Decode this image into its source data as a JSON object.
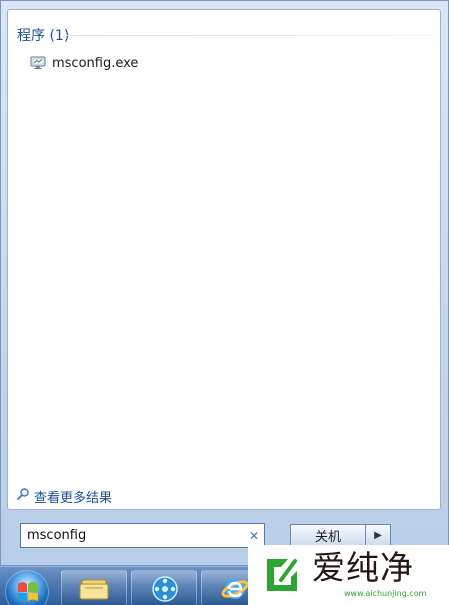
{
  "start_menu": {
    "section_title": "程序 (1)",
    "results": [
      {
        "label": "msconfig.exe",
        "icon": "system-config-icon"
      }
    ],
    "more_results_label": "查看更多结果",
    "search": {
      "value": "msconfig",
      "clear_icon": "close-icon"
    },
    "shutdown": {
      "label": "关机",
      "arrow_icon": "chevron-right-icon"
    }
  },
  "taskbar": {
    "items": [
      "start-orb-icon",
      "windows-explorer-icon",
      "media-player-icon",
      "internet-explorer-icon"
    ]
  },
  "watermark": {
    "brand": "爱纯净",
    "url": "www.aichunjing.com",
    "accent_color": "#2ea533"
  }
}
